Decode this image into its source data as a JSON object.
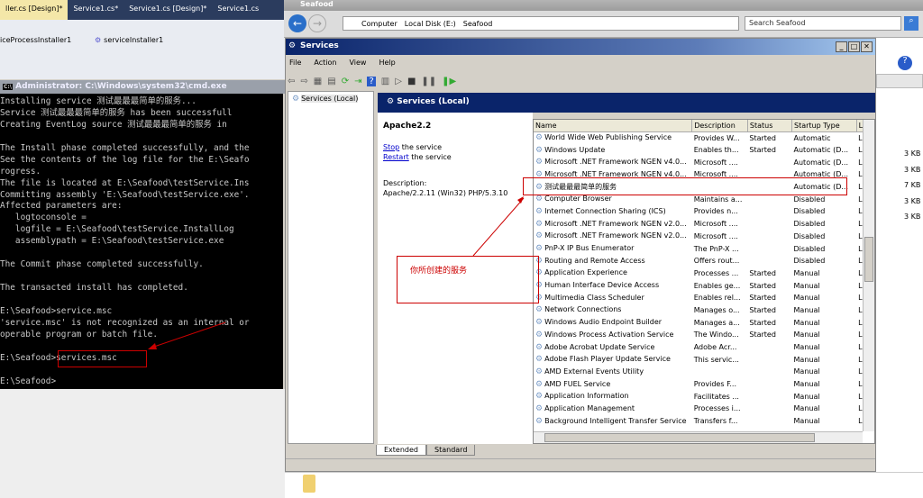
{
  "vs": {
    "tabs": [
      "ller.cs [Design]*",
      "Service1.cs*",
      "Service1.cs [Design]*",
      "Service1.cs"
    ],
    "components": [
      "iceProcessInstaller1",
      "serviceInstaller1"
    ]
  },
  "cmd": {
    "title": "Administrator: C:\\Windows\\system32\\cmd.exe",
    "lines": [
      "Installing service 测试最最最简单的服务...",
      "Service 测试最最最简单的服务 has been successfull",
      "Creating EventLog source 测试最最最简单的服务 in",
      "",
      "The Install phase completed successfully, and the",
      "See the contents of the log file for the E:\\Seafo",
      "rogress.",
      "The file is located at E:\\Seafood\\testService.Ins",
      "Committing assembly 'E:\\Seafood\\testService.exe'.",
      "Affected parameters are:",
      "   logtoconsole =",
      "   logfile = E:\\Seafood\\testService.InstallLog",
      "   assemblypath = E:\\Seafood\\testService.exe",
      "",
      "The Commit phase completed successfully.",
      "",
      "The transacted install has completed.",
      "",
      "E:\\Seafood>service.msc",
      "'service.msc' is not recognized as an internal or",
      "operable program or batch file.",
      "",
      "E:\\Seafood>services.msc",
      "",
      "E:\\Seafood>"
    ]
  },
  "explorer": {
    "title": "Seafood",
    "breadcrumb": [
      "Computer",
      "Local Disk (E:)",
      "Seafood"
    ],
    "search_placeholder": "Search Seafood",
    "sizes": [
      "3 KB",
      "3 KB",
      "7 KB",
      "3 KB",
      "3 KB"
    ]
  },
  "services": {
    "title": "Services",
    "menu": [
      "File",
      "Action",
      "View",
      "Help"
    ],
    "tree_item": "Services (Local)",
    "header": "Services (Local)",
    "detail": {
      "name": "Apache2.2",
      "stop_link": "Stop",
      "stop_rest": " the service",
      "restart_link": "Restart",
      "restart_rest": " the service",
      "desc_label": "Description:",
      "desc": "Apache/2.2.11 (Win32) PHP/5.3.10"
    },
    "columns": [
      "Name",
      "Description",
      "Status",
      "Startup Type",
      "L"
    ],
    "rows": [
      [
        "World Wide Web Publishing Service",
        "Provides W...",
        "Started",
        "Automatic",
        "L"
      ],
      [
        "Windows Update",
        "Enables th...",
        "Started",
        "Automatic (D...",
        "L"
      ],
      [
        "Microsoft .NET Framework NGEN v4.0...",
        "Microsoft ....",
        "",
        "Automatic (D...",
        "L"
      ],
      [
        "Microsoft .NET Framework NGEN v4.0...",
        "Microsoft ....",
        "",
        "Automatic (D...",
        "L"
      ],
      [
        "测试最最最简单的服务",
        "",
        "",
        "Automatic (D...",
        "L"
      ],
      [
        "Computer Browser",
        "Maintains a...",
        "",
        "Disabled",
        "L"
      ],
      [
        "Internet Connection Sharing (ICS)",
        "Provides n...",
        "",
        "Disabled",
        "L"
      ],
      [
        "Microsoft .NET Framework NGEN v2.0...",
        "Microsoft ....",
        "",
        "Disabled",
        "L"
      ],
      [
        "Microsoft .NET Framework NGEN v2.0...",
        "Microsoft ....",
        "",
        "Disabled",
        "L"
      ],
      [
        "PnP-X IP Bus Enumerator",
        "The PnP-X ...",
        "",
        "Disabled",
        "L"
      ],
      [
        "Routing and Remote Access",
        "Offers rout...",
        "",
        "Disabled",
        "L"
      ],
      [
        "Application Experience",
        "Processes ...",
        "Started",
        "Manual",
        "L"
      ],
      [
        "Human Interface Device Access",
        "Enables ge...",
        "Started",
        "Manual",
        "L"
      ],
      [
        "Multimedia Class Scheduler",
        "Enables rel...",
        "Started",
        "Manual",
        "L"
      ],
      [
        "Network Connections",
        "Manages o...",
        "Started",
        "Manual",
        "L"
      ],
      [
        "Windows Audio Endpoint Builder",
        "Manages a...",
        "Started",
        "Manual",
        "L"
      ],
      [
        "Windows Process Activation Service",
        "The Windo...",
        "Started",
        "Manual",
        "L"
      ],
      [
        "Adobe Acrobat Update Service",
        "Adobe Acr...",
        "",
        "Manual",
        "L"
      ],
      [
        "Adobe Flash Player Update Service",
        "This servic...",
        "",
        "Manual",
        "L"
      ],
      [
        "AMD External Events Utility",
        "",
        "",
        "Manual",
        "L"
      ],
      [
        "AMD FUEL Service",
        "Provides F...",
        "",
        "Manual",
        "L"
      ],
      [
        "Application Information",
        "Facilitates ...",
        "",
        "Manual",
        "L"
      ],
      [
        "Application Management",
        "Processes i...",
        "",
        "Manual",
        "L"
      ],
      [
        "Background Intelligent Transfer Service",
        "Transfers f...",
        "",
        "Manual",
        "L"
      ]
    ],
    "tabs": [
      "Extended",
      "Standard"
    ]
  },
  "annotation": {
    "callout": "你所创建的服务"
  }
}
